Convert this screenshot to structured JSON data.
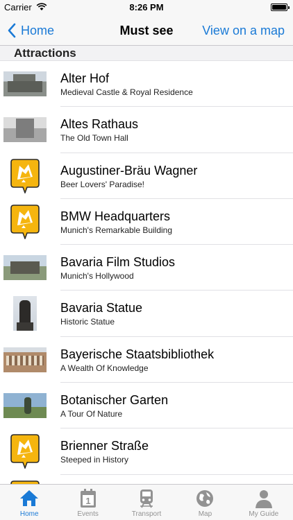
{
  "status_bar": {
    "carrier": "Carrier",
    "time": "8:26 PM"
  },
  "nav": {
    "back_label": "Home",
    "title": "Must see",
    "right_label": "View on a map"
  },
  "section": {
    "title": "Attractions"
  },
  "attractions": [
    {
      "title": "Alter Hof",
      "subtitle": "Medieval Castle & Royal Residence",
      "thumb": "photo",
      "photo": "alter"
    },
    {
      "title": "Altes Rathaus",
      "subtitle": "The Old Town Hall",
      "thumb": "photo",
      "photo": "rathaus"
    },
    {
      "title": "Augustiner-Bräu Wagner",
      "subtitle": "Beer Lovers' Paradise!",
      "thumb": "badge"
    },
    {
      "title": "BMW Headquarters",
      "subtitle": "Munich's Remarkable Building",
      "thumb": "badge"
    },
    {
      "title": "Bavaria Film Studios",
      "subtitle": "Munich's Hollywood",
      "thumb": "photo",
      "photo": "film"
    },
    {
      "title": "Bavaria Statue",
      "subtitle": "Historic Statue",
      "thumb": "photo",
      "photo": "statue"
    },
    {
      "title": "Bayerische Staatsbibliothek",
      "subtitle": "A Wealth Of Knowledge",
      "thumb": "photo",
      "photo": "biblio"
    },
    {
      "title": "Botanischer Garten",
      "subtitle": "A Tour Of Nature",
      "thumb": "photo",
      "photo": "garten"
    },
    {
      "title": "Brienner Straße",
      "subtitle": "Steeped in History",
      "thumb": "badge"
    },
    {
      "title": "",
      "subtitle": "",
      "thumb": "badge"
    }
  ],
  "tabs": [
    {
      "label": "Home",
      "icon": "home-icon",
      "active": true
    },
    {
      "label": "Events",
      "icon": "calendar-icon",
      "active": false
    },
    {
      "label": "Transport",
      "icon": "train-icon",
      "active": false
    },
    {
      "label": "Map",
      "icon": "globe-icon",
      "active": false
    },
    {
      "label": "My Guide",
      "icon": "person-icon",
      "active": false
    }
  ],
  "colors": {
    "accent": "#1a7ad6",
    "badge_yellow": "#f5b50f",
    "inactive_tab": "#929292"
  }
}
